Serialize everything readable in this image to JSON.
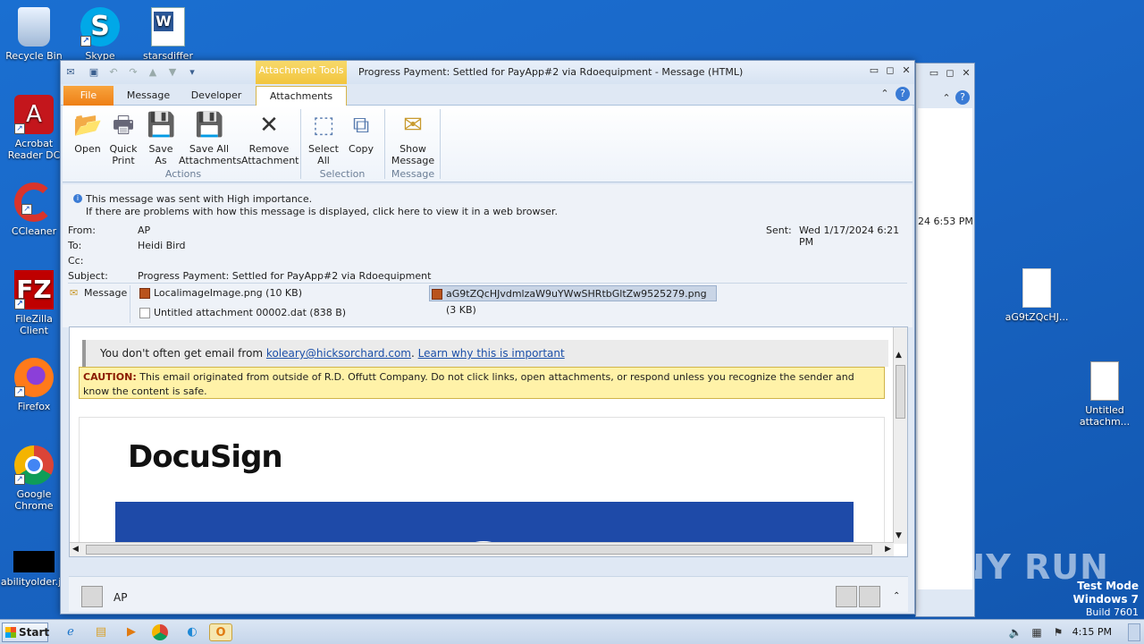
{
  "desktop": {
    "icons": [
      {
        "label": "Recycle Bin"
      },
      {
        "label": "Skype"
      },
      {
        "label": "starsdiffer"
      },
      {
        "label": "Acrobat Reader DC"
      },
      {
        "label": "CCleaner"
      },
      {
        "label": "FileZilla Client"
      },
      {
        "label": "Firefox"
      },
      {
        "label": "Google Chrome"
      },
      {
        "label": "abilityolder.jp"
      },
      {
        "label": "aG9tZQcHJ..."
      },
      {
        "label": "Untitled attachm..."
      }
    ],
    "watermark": "ANY RUN",
    "test_mode": {
      "line1": "Test Mode",
      "line2": "Windows 7",
      "line3": "Build 7601"
    }
  },
  "bg_window": {
    "time": "24 6:53 PM"
  },
  "window": {
    "title": "Progress Payment: Settled for PayApp#2 via Rdoequipment  -  Message (HTML)",
    "context_tab": "Attachment Tools",
    "tabs": {
      "file": "File",
      "message": "Message",
      "developer": "Developer",
      "attachments": "Attachments"
    },
    "ribbon": {
      "open": "Open",
      "quick_print_1": "Quick",
      "quick_print_2": "Print",
      "save_as_1": "Save",
      "save_as_2": "As",
      "save_all_1": "Save All",
      "save_all_2": "Attachments",
      "remove_1": "Remove",
      "remove_2": "Attachment",
      "select_all_1": "Select",
      "select_all_2": "All",
      "copy": "Copy",
      "show_message_1": "Show",
      "show_message_2": "Message",
      "group_actions": "Actions",
      "group_selection": "Selection",
      "group_message": "Message"
    },
    "info": {
      "line1": "This message was sent with High importance.",
      "line2": "If there are problems with how this message is displayed, click here to view it in a web browser."
    },
    "header": {
      "from_label": "From:",
      "from": "AP",
      "to_label": "To:",
      "to": "Heidi Bird",
      "cc_label": "Cc:",
      "cc": "",
      "subject_label": "Subject:",
      "subject": "Progress Payment: Settled for PayApp#2 via Rdoequipment",
      "sent_label": "Sent:",
      "sent": "Wed 1/17/2024 6:21 PM"
    },
    "attachments": {
      "message_label": "Message",
      "items": [
        "LocalimageImage.png (10 KB)",
        "aG9tZQcHJvdmlzaW9uYWwSHRtbGltZw9525279.png (3 KB)",
        "Untitled attachment 00002.dat (838 B)"
      ]
    },
    "body": {
      "notice_prefix": "You don't often get email from ",
      "notice_email": "koleary@hicksorchard.com",
      "notice_sep": ". ",
      "notice_link": "Learn why this is important",
      "caution_label": "CAUTION:",
      "caution_text": " This email originated from outside of R.D. Offutt Company. Do not click links, open attachments, or respond unless you recognize the sender and know the content is safe.",
      "logo": "DocuSign"
    },
    "people": {
      "name": "AP"
    }
  },
  "taskbar": {
    "start": "Start",
    "clock": "4:15 PM"
  }
}
